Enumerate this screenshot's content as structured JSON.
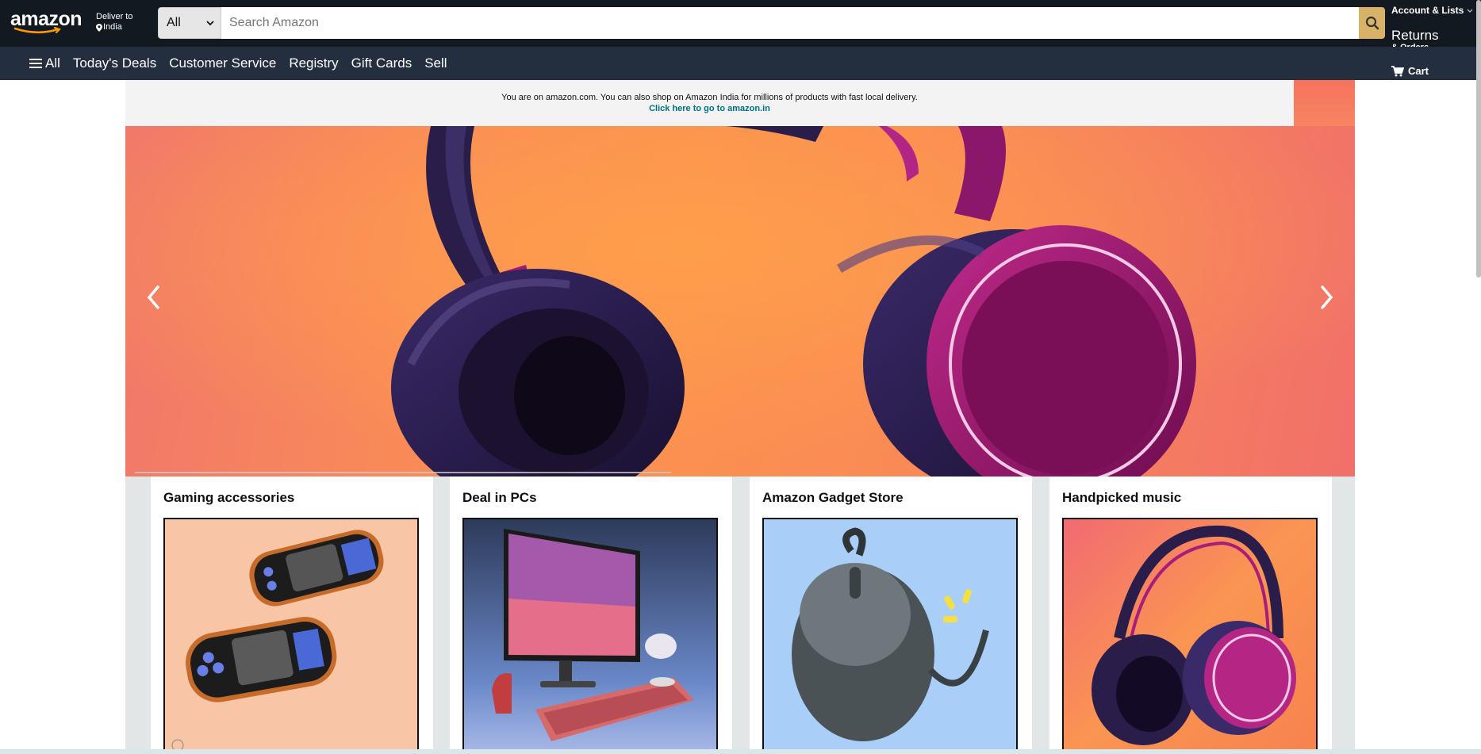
{
  "header": {
    "logo_text": "amazon",
    "deliver_label": "Deliver to",
    "deliver_location": "India",
    "search_category": "All",
    "search_placeholder": "Search Amazon",
    "account_lists": "Account & Lists",
    "returns": "Returns",
    "orders": "& Orders",
    "cart": "Cart"
  },
  "subnav": {
    "items": [
      {
        "label": "All"
      },
      {
        "label": "Today's Deals"
      },
      {
        "label": "Customer Service"
      },
      {
        "label": "Registry"
      },
      {
        "label": "Gift Cards"
      },
      {
        "label": "Sell"
      }
    ]
  },
  "notice": {
    "text": "You are on amazon.com. You can also shop on Amazon India for millions of products with fast local delivery.",
    "link": "Click here to go to amazon.in"
  },
  "hero": {
    "image": "headphones-banner",
    "prev_icon": "chevron-left-icon",
    "next_icon": "chevron-right-icon"
  },
  "cards": [
    {
      "title": "Gaming accessories",
      "image": "handheld-consoles"
    },
    {
      "title": "Deal in PCs",
      "image": "desktop-pc"
    },
    {
      "title": "Amazon Gadget Store",
      "image": "computer-mouse"
    },
    {
      "title": "Handpicked music",
      "image": "headphones"
    }
  ],
  "colors": {
    "header_bg": "#131921",
    "subnav_bg": "#232f3e",
    "search_button": "#febd69",
    "link": "#007185"
  }
}
